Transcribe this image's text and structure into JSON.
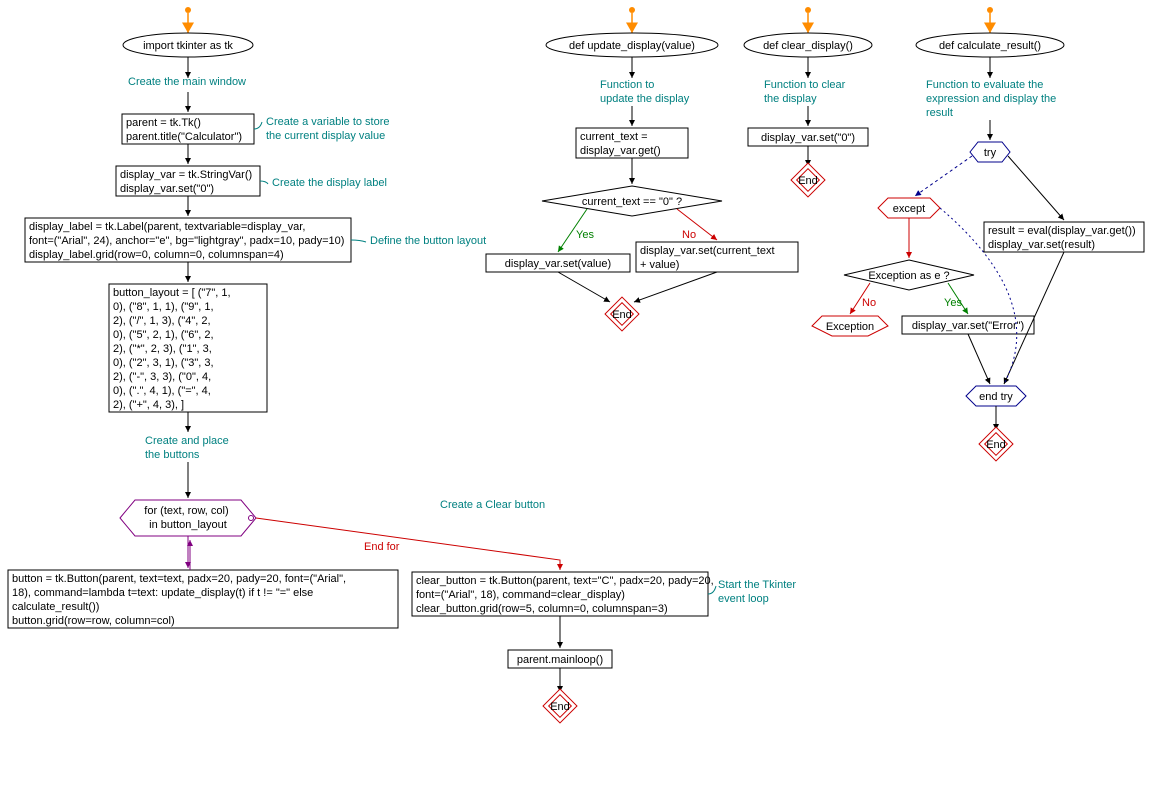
{
  "main": {
    "import": "import tkinter as tk",
    "comment_main_window": "Create the main window",
    "parent_lines": [
      "parent = tk.Tk()",
      "parent.title(\"Calculator\")"
    ],
    "comment_display_var": "Create a variable to store\nthe current display value",
    "display_var_lines": [
      "display_var = tk.StringVar()",
      "display_var.set(\"0\")"
    ],
    "comment_display_label": "Create the display label",
    "display_label_lines": [
      "display_label = tk.Label(parent, textvariable=display_var,",
      "font=(\"Arial\", 24), anchor=\"e\", bg=\"lightgray\", padx=10, pady=10)",
      "display_label.grid(row=0, column=0, columnspan=4)"
    ],
    "comment_button_layout": "Define the button layout",
    "button_layout_lines": [
      "button_layout = [ (\"7\", 1,",
      "0), (\"8\", 1, 1), (\"9\", 1,",
      "2), (\"/\", 1, 3), (\"4\", 2,",
      "0), (\"5\", 2, 1), (\"6\", 2,",
      "2), (\"*\", 2, 3), (\"1\", 3,",
      "0), (\"2\", 3, 1), (\"3\", 3,",
      "2), (\"-\", 3, 3), (\"0\", 4,",
      "0), (\".\", 4, 1), (\"=\", 4,",
      "2), (\"+\", 4, 3), ]"
    ],
    "comment_create_buttons": "Create and place\nthe buttons",
    "for_loop": "for (text, row, col)\nin button_layout",
    "button_lines": [
      "button = tk.Button(parent, text=text, padx=20, pady=20, font=(\"Arial\",",
      "18), command=lambda t=text: update_display(t) if t != \"=\" else",
      "calculate_result())",
      "button.grid(row=row, column=col)"
    ],
    "end_for": "End for",
    "comment_clear_button": "Create a Clear button",
    "clear_button_lines": [
      "clear_button = tk.Button(parent, text=\"C\", padx=20, pady=20,",
      "font=(\"Arial\", 18), command=clear_display)",
      "clear_button.grid(row=5, column=0, columnspan=3)"
    ],
    "comment_mainloop": "Start the Tkinter\nevent loop",
    "mainloop": "parent.mainloop()",
    "end": "End"
  },
  "update": {
    "def": "def update_display(value)",
    "comment": "Function to\nupdate the display",
    "current_text_lines": [
      "current_text =",
      "display_var.get()"
    ],
    "condition": "current_text == \"0\" ?",
    "yes_branch": "display_var.set(value)",
    "no_branch": "display_var.set(current_text\n+ value)",
    "yes": "Yes",
    "no": "No",
    "end": "End"
  },
  "clear": {
    "def": "def clear_display()",
    "comment": "Function to clear\nthe display",
    "body": "display_var.set(\"0\")",
    "end": "End"
  },
  "calc": {
    "def": "def calculate_result()",
    "comment": "Function to evaluate the\nexpression and display the\nresult",
    "try": "try",
    "except": "except",
    "condition": "Exception as e ?",
    "yes": "Yes",
    "no": "No",
    "exception": "Exception",
    "error_branch": "display_var.set(\"Error\")",
    "result_lines": [
      "result = eval(display_var.get())",
      "display_var.set(result)"
    ],
    "end_try": "end try",
    "end": "End"
  }
}
